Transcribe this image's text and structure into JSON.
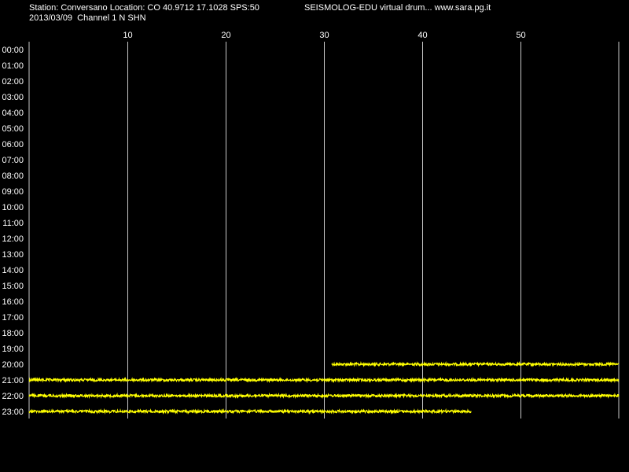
{
  "header": {
    "station_line": "Station: Conversano Location: CO 40.9712 17.1028 SPS:50",
    "title": "SEISMOLOG-EDU virtual drum... www.sara.pg.it",
    "date_line": "2013/03/09  Channel 1 N SHN"
  },
  "colors": {
    "background": "#000000",
    "trace": "#ffff00",
    "grid": "#c8c8c8",
    "text": "#ffffff"
  },
  "chart_data": {
    "type": "line",
    "title": "SEISMOLOG-EDU virtual drum... www.sara.pg.it",
    "xlabel": "",
    "ylabel": "",
    "xlim": [
      0,
      60
    ],
    "x_ticks": [
      10,
      20,
      30,
      40,
      50
    ],
    "y_categories": [
      "00:00",
      "01:00",
      "02:00",
      "03:00",
      "04:00",
      "05:00",
      "06:00",
      "07:00",
      "08:00",
      "09:00",
      "10:00",
      "11:00",
      "12:00",
      "13:00",
      "14:00",
      "15:00",
      "16:00",
      "17:00",
      "18:00",
      "19:00",
      "20:00",
      "21:00",
      "22:00",
      "23:00"
    ],
    "grid": "vertical",
    "series": [
      {
        "hour": "20:00",
        "start_min": 30.8,
        "end_min": 60
      },
      {
        "hour": "21:00",
        "start_min": 0,
        "end_min": 60
      },
      {
        "hour": "22:00",
        "start_min": 0,
        "end_min": 60
      },
      {
        "hour": "23:00",
        "start_min": 0,
        "end_min": 45
      }
    ]
  }
}
